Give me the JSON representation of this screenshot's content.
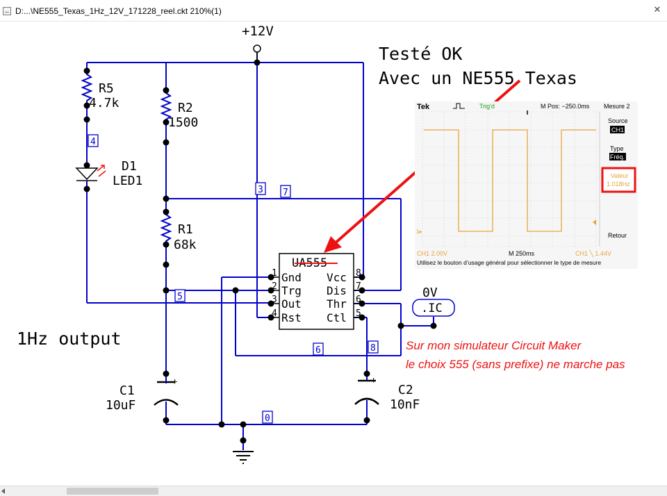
{
  "window": {
    "title": "D:...\\NE555_Texas_1Hz_12V_171228_reel.ckt 210%(1)",
    "close_glyph": "✕"
  },
  "schematic": {
    "supply_label": "+12V",
    "note_line1": "Testé OK",
    "note_line2": "Avec un NE555 Texas",
    "output_label": "1Hz output",
    "simulator_note_line1": "Sur mon simulateur Circuit Maker",
    "simulator_note_line2": "le choix 555 (sans prefixe)  ne marche pas",
    "ic_voltage": "0V",
    "ic_label": ".IC",
    "components": {
      "r5": {
        "name": "R5",
        "value": "4.7k"
      },
      "r2": {
        "name": "R2",
        "value": "1500"
      },
      "r1": {
        "name": "R1",
        "value": "68k"
      },
      "d1": {
        "name": "D1",
        "value": "LED1"
      },
      "c1": {
        "name": "C1",
        "value": "10uF"
      },
      "c2": {
        "name": "C2",
        "value": "10nF"
      },
      "u1": {
        "name": "UA555"
      }
    },
    "pins": {
      "p1": "Gnd",
      "p2": "Trg",
      "p3": "Out",
      "p4": "Rst",
      "p5": "Ctl",
      "p6": "Thr",
      "p7": "Dis",
      "p8": "Vcc",
      "n1": "1",
      "n2": "2",
      "n3": "3",
      "n4": "4",
      "n5": "5",
      "n6": "6",
      "n7": "7",
      "n8": "8"
    },
    "nodes": {
      "n0": "0",
      "n3": "3",
      "n4": "4",
      "n5": "5",
      "n6": "6",
      "n7": "7",
      "n8": "8"
    },
    "colors": {
      "wire": "#0000cc",
      "arrow": "#ee1111",
      "note_red": "#ee1111",
      "scope_trace": "#e8a43a"
    }
  },
  "oscilloscope": {
    "brand": "Tek",
    "trig_status": "Trig'd",
    "mpos": "M Pos: −250.0ms",
    "menu_title": "Mesure 2",
    "source_label": "Source",
    "source_value": "CH1",
    "type_label": "Type",
    "type_value": "Fréq.",
    "value_label": "Valeur",
    "value_reading": "1.018Hz",
    "retour_label": "Retour",
    "ch1_scale": "CH1  2.00V",
    "timebase": "M 250ms",
    "trigger_info": "CH1 ╲ 1.44V",
    "help_text": "Utilisez le bouton d’usage général pour sélectionner le type de mesure",
    "ch1_marker": "1▸"
  }
}
